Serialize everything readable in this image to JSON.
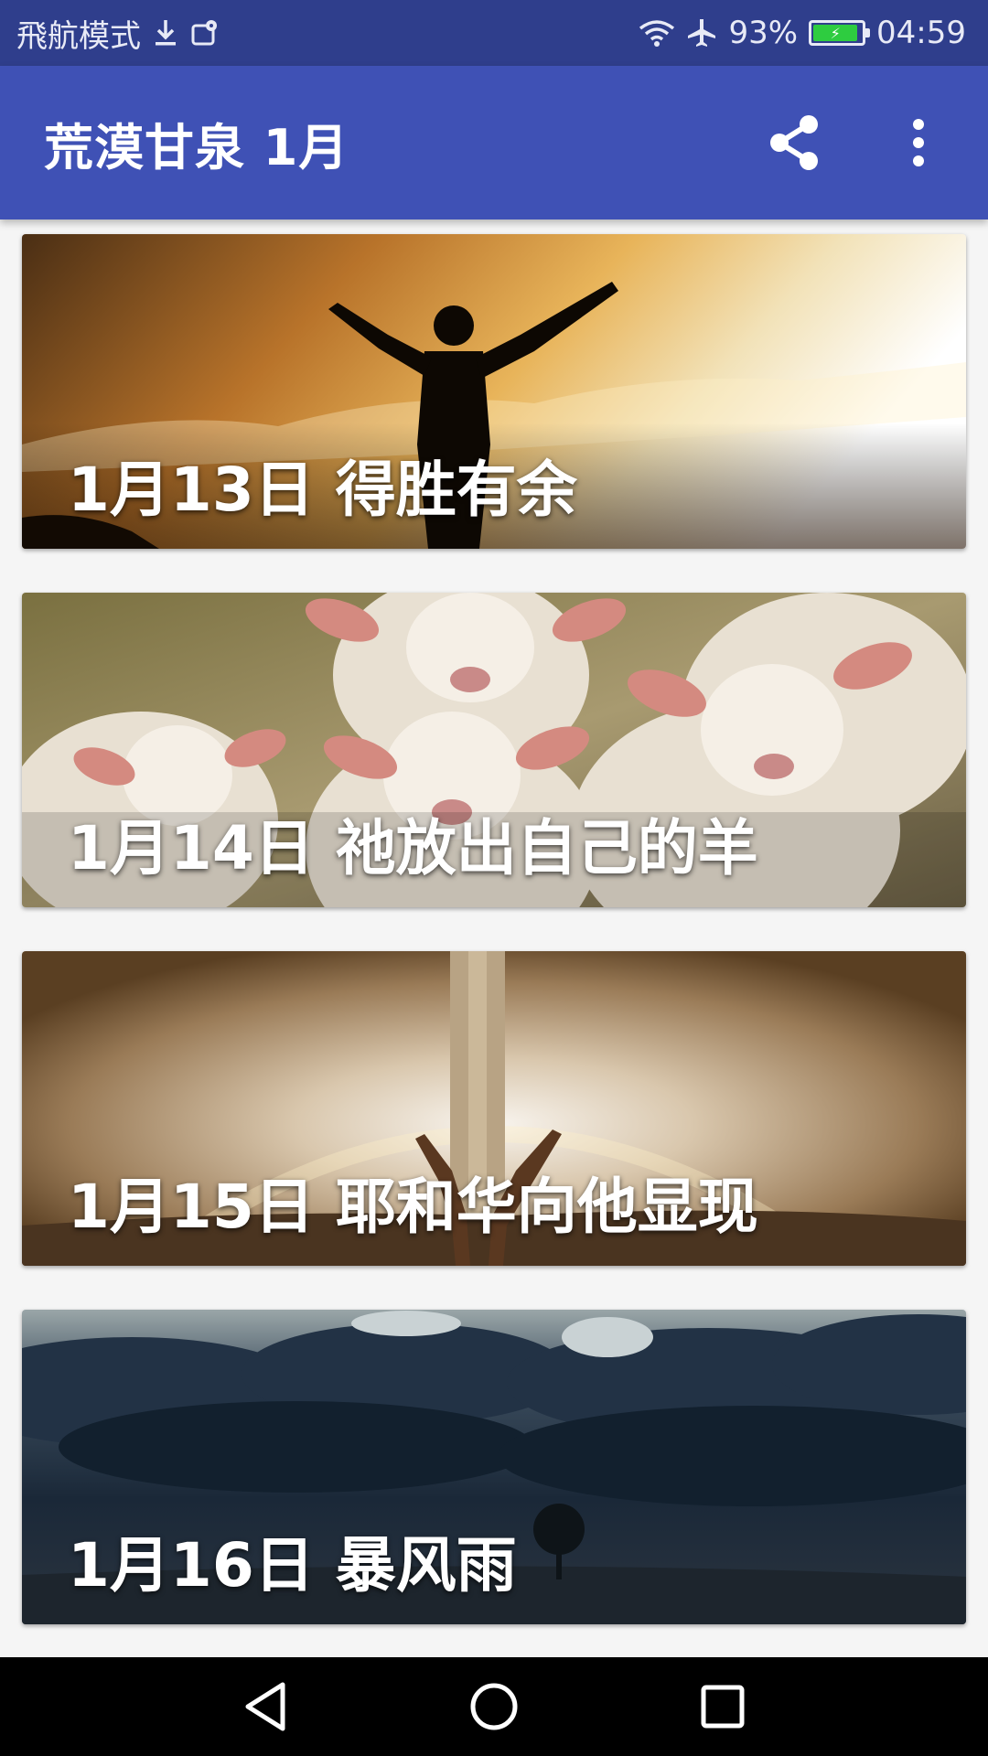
{
  "status_bar": {
    "left_text": "飛航模式",
    "battery_percent": "93%",
    "time": "04:59",
    "icons": [
      "download-icon",
      "location-settings-icon",
      "wifi-icon",
      "airplane-icon",
      "battery-icon"
    ],
    "battery_color": "#2ecc40"
  },
  "app_bar": {
    "title": "荒漠甘泉 1月",
    "actions": [
      "share-icon",
      "more-vert-icon"
    ],
    "color": "#3f51b5"
  },
  "cards": [
    {
      "title": "1月13日 得胜有余"
    },
    {
      "title": "1月14日 祂放出自己的羊"
    },
    {
      "title": "1月15日 耶和华向他显现"
    },
    {
      "title": "1月16日 暴风雨"
    }
  ],
  "nav_bar": {
    "buttons": [
      "back-icon",
      "home-icon",
      "recents-icon"
    ]
  }
}
